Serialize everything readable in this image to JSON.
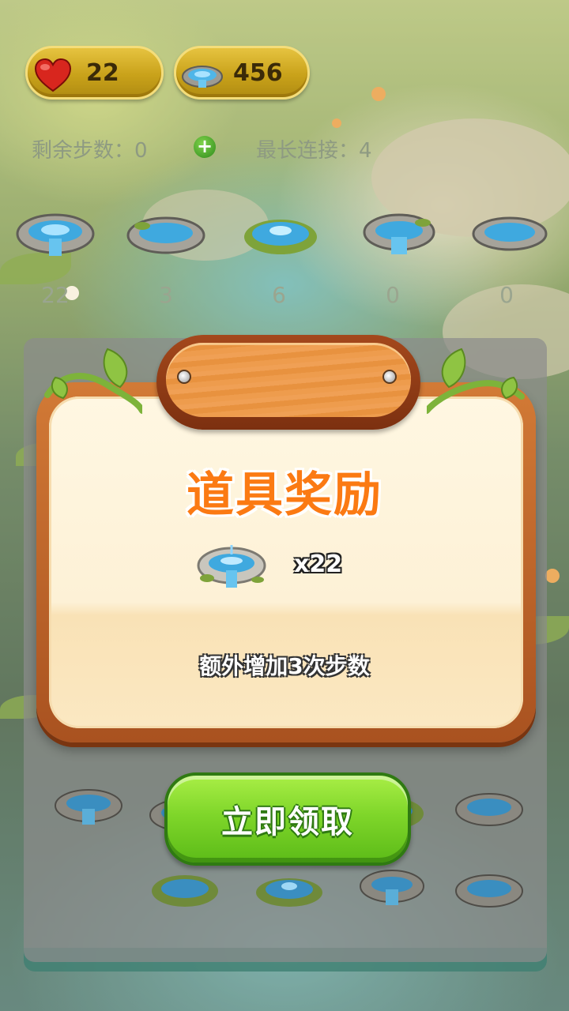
{
  "hud": {
    "lives": "22",
    "wells": "456",
    "steps_label": "剩余步数：",
    "steps_value": "0",
    "combo_label": "最长连接：",
    "combo_value": "4",
    "plus_symbol": "+"
  },
  "well_counts": [
    "22",
    "3",
    "6",
    "0",
    "0"
  ],
  "reward_dialog": {
    "title": "道具奖励",
    "item_quantity": "x22",
    "description": "额外增加3次步数",
    "claim_label": "立即领取"
  },
  "colors": {
    "title_orange": "#fb7a13",
    "button_green": "#7fd62a",
    "panel_wood": "#c46a2c",
    "hud_gold": "#d4b02a"
  },
  "icons": {
    "lives": "heart-icon",
    "wells": "well-icon",
    "add_steps": "plus-icon"
  }
}
